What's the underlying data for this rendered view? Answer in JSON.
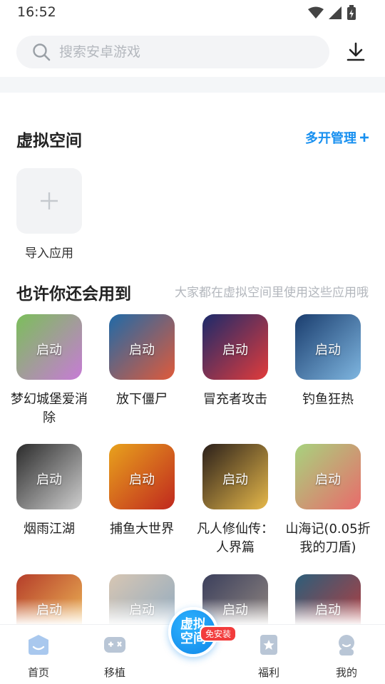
{
  "status": {
    "time": "16:52"
  },
  "search": {
    "placeholder": "搜索安卓游戏"
  },
  "virtual_space": {
    "title": "虚拟空间",
    "manage_label": "多开管理",
    "import_label": "导入应用"
  },
  "suggest": {
    "title": "也许你还会用到",
    "subtitle": "大家都在虚拟空间里使用这些应用哦"
  },
  "launch_label": "启动",
  "apps": [
    {
      "name": "梦幻城堡爱消除",
      "color1": "#7bbf5a",
      "color2": "#c77bd6"
    },
    {
      "name": "放下僵尸",
      "color1": "#1f6aa8",
      "color2": "#e05a3a"
    },
    {
      "name": "冒充者攻击",
      "color1": "#1b2a6b",
      "color2": "#e23b3b"
    },
    {
      "name": "钓鱼狂热",
      "color1": "#1a3d6e",
      "color2": "#7fb6e0"
    },
    {
      "name": "烟雨江湖",
      "color1": "#2b2b2b",
      "color2": "#cfcfcf"
    },
    {
      "name": "捕鱼大世界",
      "color1": "#e8a21d",
      "color2": "#c0281e"
    },
    {
      "name": "凡人修仙传：人界篇",
      "color1": "#2a1f1a",
      "color2": "#e6b84a"
    },
    {
      "name": "山海记(0.05折我的刀盾)",
      "color1": "#a7d37e",
      "color2": "#e96b6b"
    },
    {
      "name": "",
      "color1": "#b53d2a",
      "color2": "#f2c15a"
    },
    {
      "name": "",
      "color1": "#d7c6b3",
      "color2": "#8aa8c2"
    },
    {
      "name": "",
      "color1": "#3b3f5c",
      "color2": "#9b8f85"
    },
    {
      "name": "",
      "color1": "#2c5e7a",
      "color2": "#c23a3a"
    }
  ],
  "nav": {
    "home": "首页",
    "transplant": "移植",
    "center_line1": "虚拟",
    "center_line2": "空间",
    "badge": "免安装",
    "welfare": "福利",
    "mine": "我的"
  },
  "colors": {
    "accent": "#1890f0",
    "badge": "#f23c3c"
  }
}
